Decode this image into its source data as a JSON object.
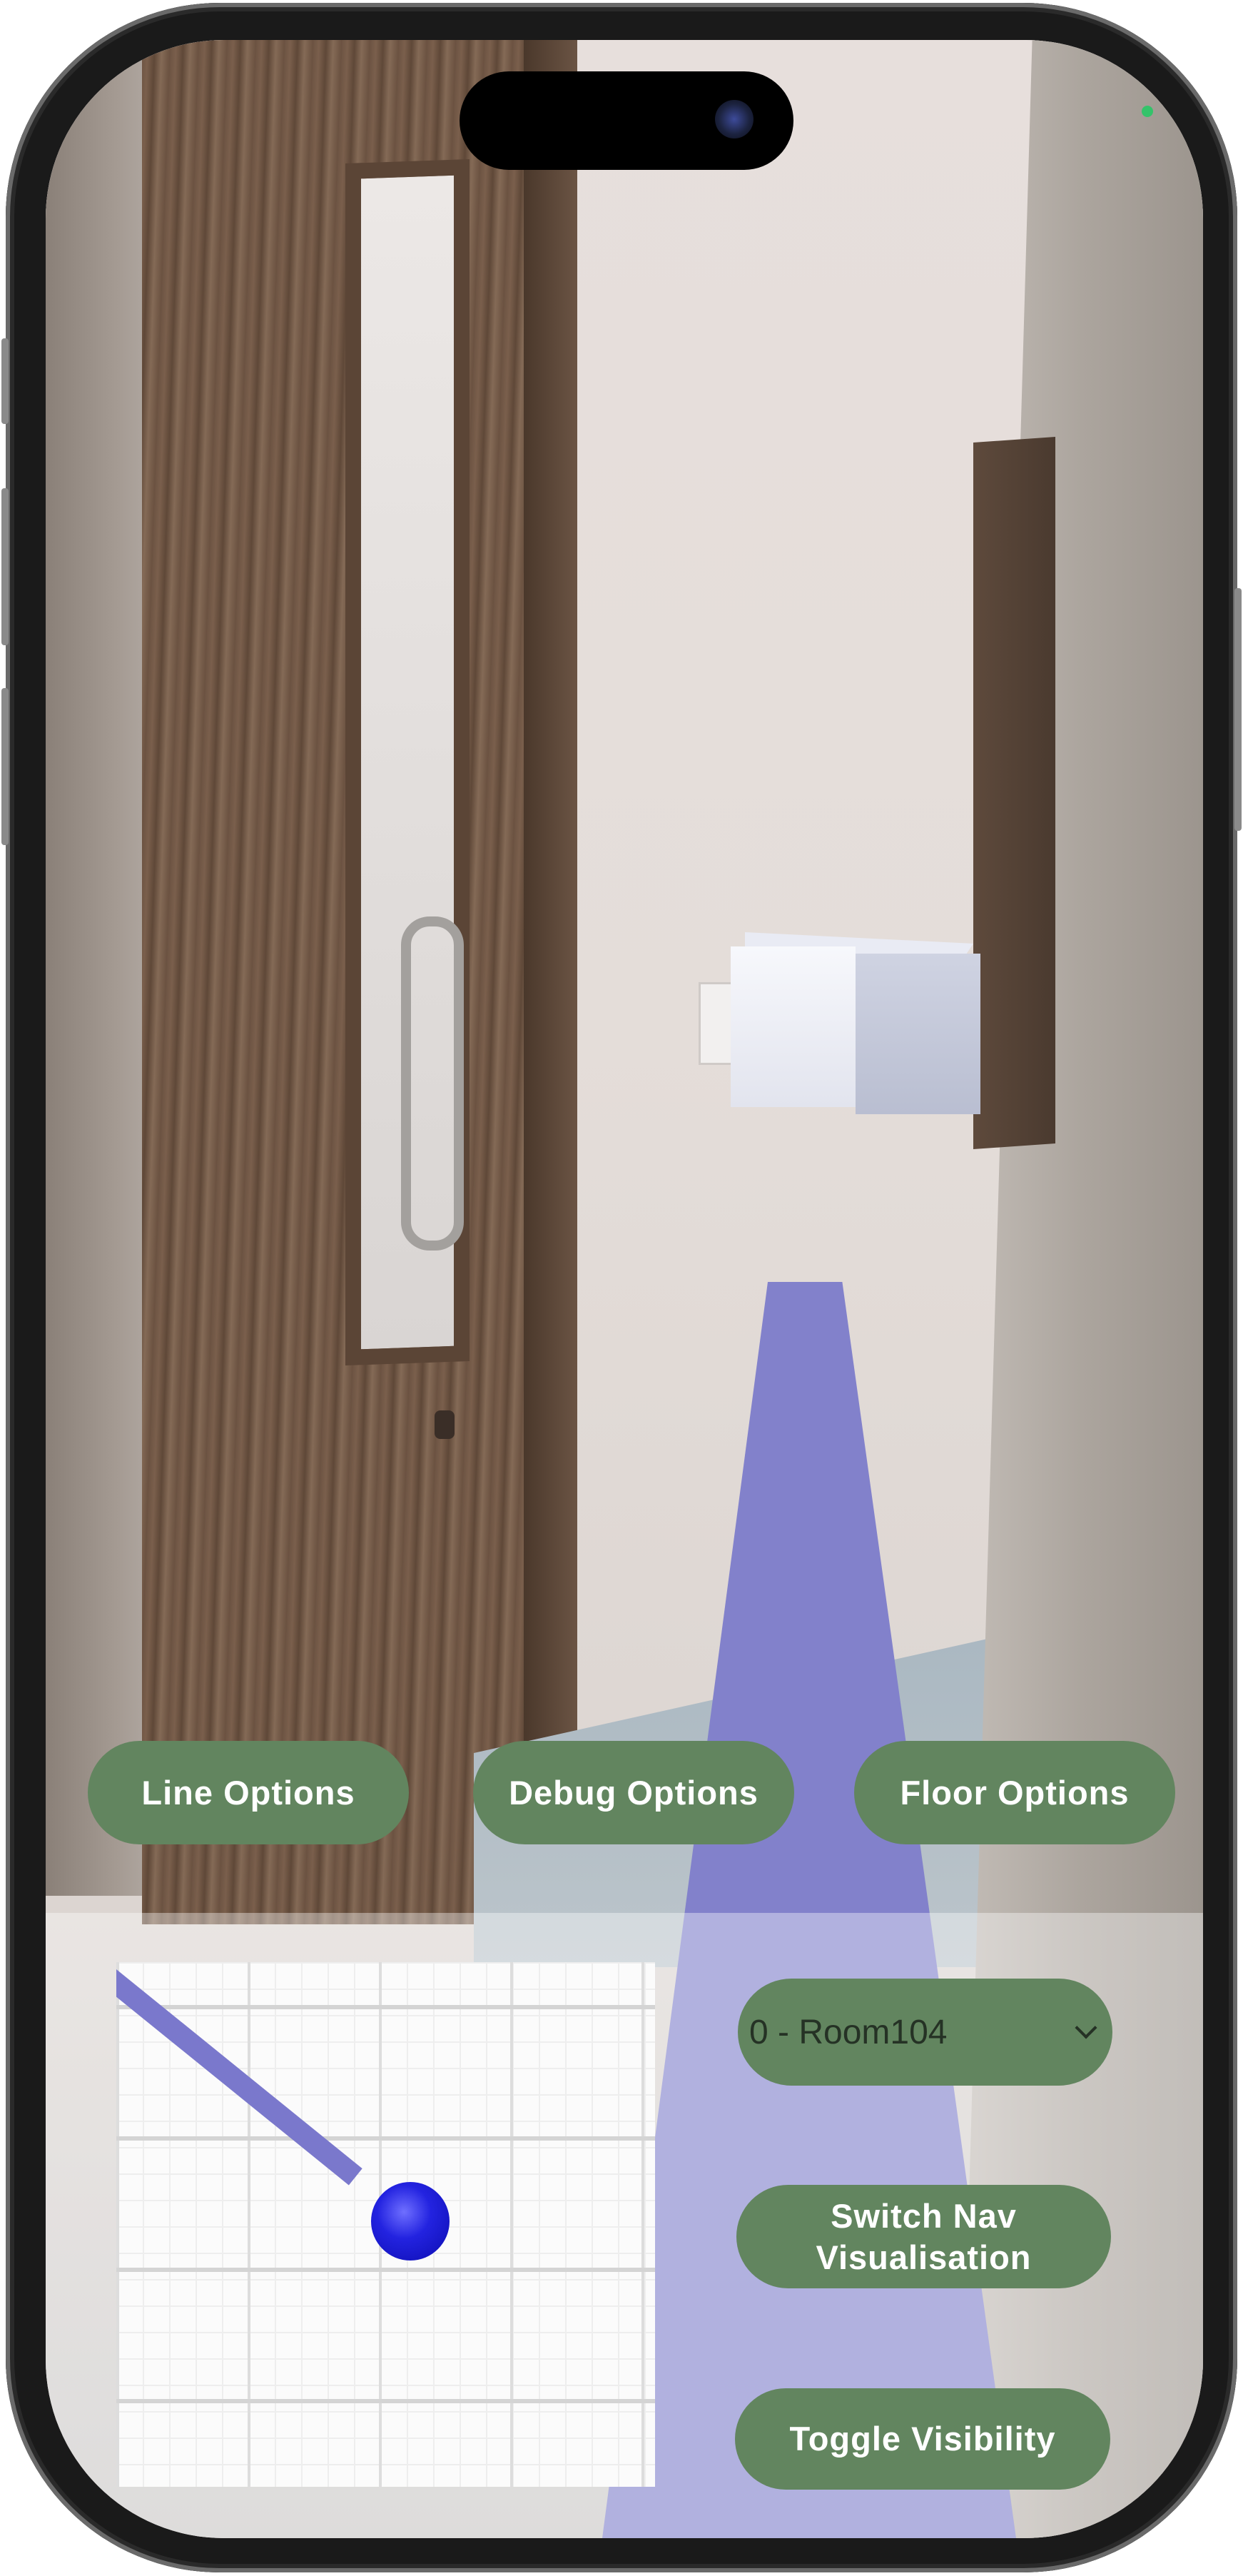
{
  "buttons": {
    "line_options": "Line Options",
    "debug_options": "Debug Options",
    "floor_options": "Floor Options",
    "switch_nav_line1": "Switch Nav",
    "switch_nav_line2": "Visualisation",
    "toggle_visibility": "Toggle Visibility"
  },
  "destination_select": {
    "selected_value": "0 - Room104"
  },
  "colors": {
    "button_bg": "#62855f",
    "button_text": "#ffffff",
    "nav_beam": "#8281cb",
    "map_line": "#7a78cc",
    "map_dot": "#2323e0"
  },
  "icons": {
    "dropdown": "chevron-down-icon",
    "camera": "front-camera-icon",
    "status": "privacy-indicator-icon"
  }
}
